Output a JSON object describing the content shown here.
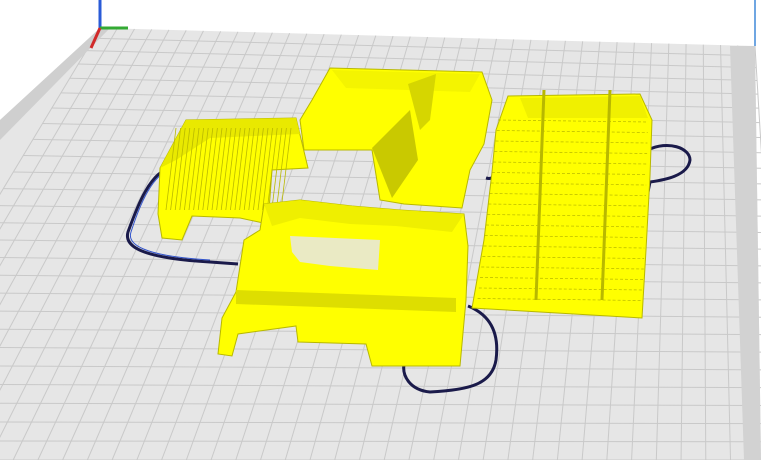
{
  "viewport": {
    "name": "3d-print-preview",
    "background": "#ffffff",
    "build_plate": {
      "color": "#e6e6e6",
      "grid_color": "#c9c9c9",
      "wall_color": "#d6d6d6",
      "wall_edge_color": "#6fa6e2"
    },
    "axes": {
      "x_color": "#33aa33",
      "y_color": "#2a5bd7",
      "z_color": "#d12a2a"
    },
    "layer_color": "#ffff00",
    "layer_shadow_color": "#b8b800",
    "skirt_color": "#1a1a4a"
  }
}
